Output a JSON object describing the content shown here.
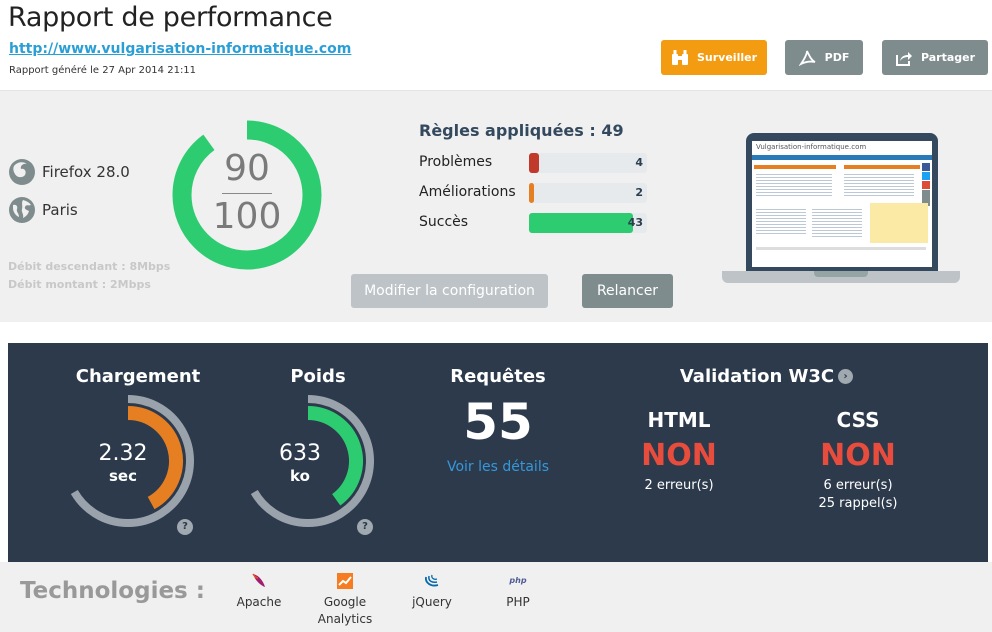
{
  "header": {
    "title": "Rapport de performance",
    "url": "http://www.vulgarisation-informatique.com",
    "generated": "Rapport généré le 27 Apr 2014 21:11",
    "buttons": {
      "monitor": "Surveiller",
      "pdf": "PDF",
      "share": "Partager"
    }
  },
  "summary": {
    "browser": "Firefox 28.0",
    "location": "Paris",
    "download": "Débit descendant : 8Mbps",
    "upload": "Débit montant : 2Mbps",
    "score": {
      "value": "90",
      "max": "100",
      "fraction": 0.9
    },
    "rules": {
      "title": "Règles appliquées : 49",
      "total": 49,
      "items": [
        {
          "label": "Problèmes",
          "value": "4",
          "count": 4,
          "color": "#c0392b"
        },
        {
          "label": "Améliorations",
          "value": "2",
          "count": 2,
          "color": "#e67e22"
        },
        {
          "label": "Succès",
          "value": "43",
          "count": 43,
          "color": "#2ecc71"
        }
      ]
    },
    "buttons": {
      "config": "Modifier la configuration",
      "rerun": "Relancer"
    },
    "preview": {
      "site_name": "Vulgarisation-informatique.com"
    }
  },
  "metrics": {
    "load": {
      "title": "Chargement",
      "value": "2.32",
      "unit": "sec",
      "fraction": 0.42,
      "color": "#e67e22"
    },
    "weight": {
      "title": "Poids",
      "value": "633",
      "unit": "ko",
      "fraction": 0.4,
      "color": "#2ecc71"
    },
    "requests": {
      "title": "Requêtes",
      "value": "55",
      "link": "Voir les détails"
    },
    "w3c": {
      "title": "Validation W3C",
      "html": {
        "label": "HTML",
        "status": "NON",
        "errors": "2 erreur(s)"
      },
      "css": {
        "label": "CSS",
        "status": "NON",
        "errors": "6 erreur(s)",
        "warnings": "25 rappel(s)"
      }
    },
    "help": "?"
  },
  "technologies": {
    "title": "Technologies :",
    "items": [
      {
        "name": "Apache",
        "icon": "apache-feather-icon"
      },
      {
        "name": "Google Analytics",
        "icon": "google-analytics-icon"
      },
      {
        "name": "jQuery",
        "icon": "jquery-icon"
      },
      {
        "name": "PHP",
        "icon": "php-icon"
      }
    ]
  }
}
